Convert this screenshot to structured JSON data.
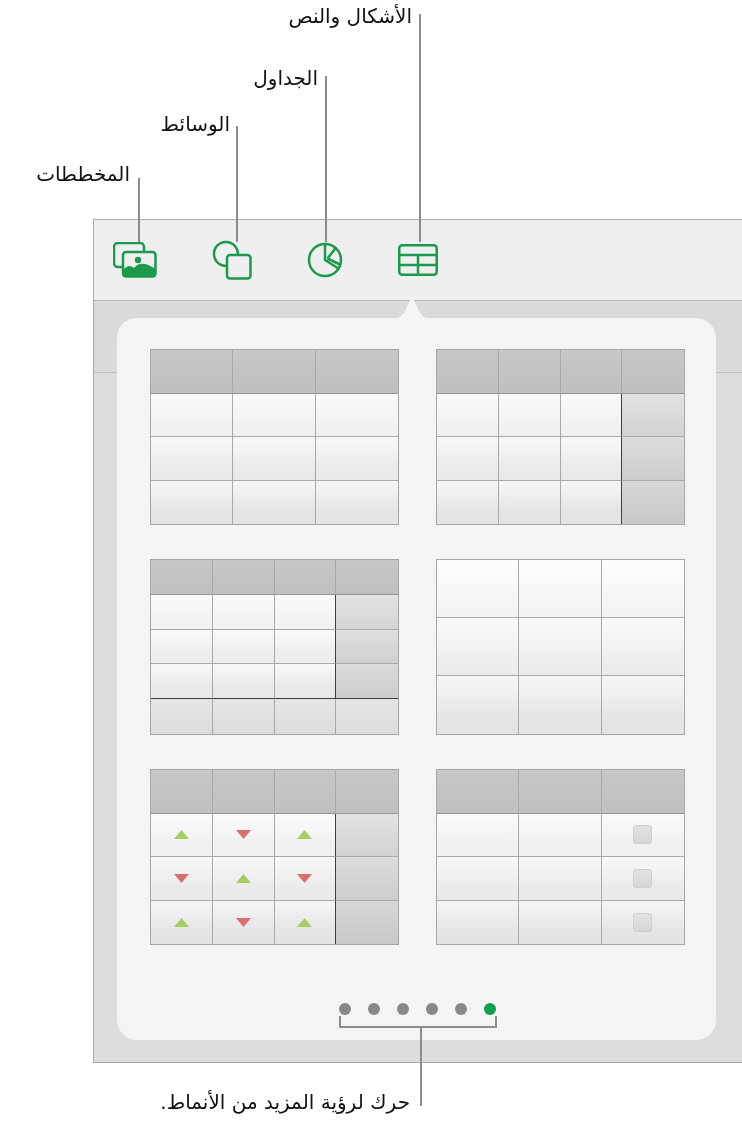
{
  "toolbar": {
    "buttons": [
      {
        "callout": "المخططات"
      },
      {
        "callout": "الوسائط"
      },
      {
        "callout": "الجداول"
      },
      {
        "callout": "الأشكال والنص"
      }
    ]
  },
  "table_styles": [
    {
      "kind": "header-row"
    },
    {
      "kind": "header-row-total-column"
    },
    {
      "kind": "header-total-footer"
    },
    {
      "kind": "plain"
    },
    {
      "kind": "trend-arrows",
      "rows": [
        {
          "cells": [
            {
              "kind": "up"
            },
            {
              "kind": "down"
            },
            {
              "kind": "up"
            }
          ]
        },
        {
          "cells": [
            {
              "kind": "down"
            },
            {
              "kind": "up"
            },
            {
              "kind": "down"
            }
          ]
        },
        {
          "cells": [
            {
              "kind": "up"
            },
            {
              "kind": "down"
            },
            {
              "kind": "up"
            }
          ]
        }
      ]
    },
    {
      "kind": "checkboxes",
      "rows": [
        {
          "checked": false
        },
        {
          "checked": false
        },
        {
          "checked": false
        }
      ]
    }
  ],
  "page_indicator": {
    "pages": [
      {
        "selected": false
      },
      {
        "selected": false
      },
      {
        "selected": false
      },
      {
        "selected": false
      },
      {
        "selected": false
      },
      {
        "selected": true
      }
    ],
    "callout": "حرك لرؤية المزيد من الأنماط."
  }
}
